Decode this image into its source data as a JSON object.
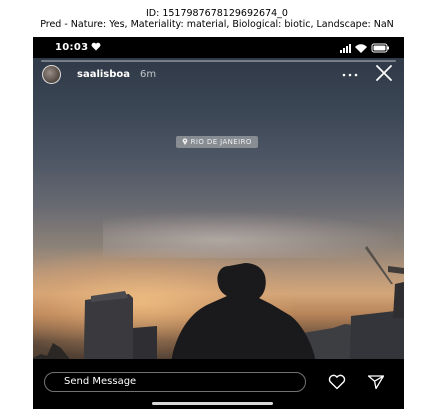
{
  "caption": {
    "id_line": "ID: 1517987678129692674_0",
    "pred_line": "Pred - Nature: Yes, Materiality: material, Biological: biotic, Landscape: NaN"
  },
  "status_bar": {
    "time": "10:03",
    "icons": [
      "heart-icon",
      "signal-icon",
      "wifi-icon",
      "battery-icon"
    ]
  },
  "story": {
    "username": "saalisboa",
    "time_ago": "6m",
    "more_icon": "more-dots-icon",
    "close_icon": "close-icon",
    "location_icon": "location-pin-icon",
    "location_sticker": "RIO DE JANEIRO",
    "scene_colors": {
      "sky_top": "#2f3947",
      "sunset": "#d2a679",
      "silhouette": "#1c1c1e"
    }
  },
  "bottom_bar": {
    "message_placeholder": "Send Message",
    "like_icon": "heart-outline-icon",
    "share_icon": "send-paper-plane-icon"
  }
}
